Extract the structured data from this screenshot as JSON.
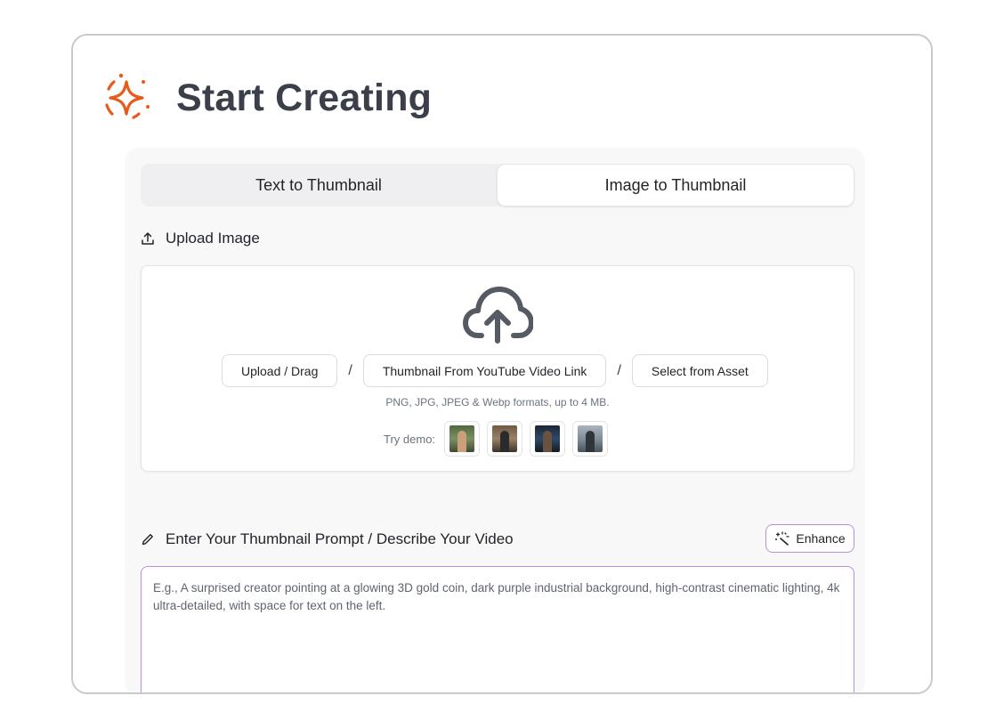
{
  "header": {
    "title": "Start Creating",
    "icon": "sparkle-icon",
    "accent_color": "#e8591a"
  },
  "tabs": [
    {
      "label": "Text to Thumbnail",
      "active": false
    },
    {
      "label": "Image to Thumbnail",
      "active": true
    }
  ],
  "upload": {
    "section_label": "Upload Image",
    "section_icon": "upload-icon",
    "cloud_icon": "cloud-upload-icon",
    "buttons": {
      "upload_drag": "Upload / Drag",
      "youtube_link": "Thumbnail From YouTube Video Link",
      "select_asset": "Select from Asset"
    },
    "separator": "/",
    "formats_hint": "PNG, JPG, JPEG & Webp formats, up to 4 MB.",
    "demo_label": "Try demo:",
    "demo_count": 4
  },
  "prompt": {
    "section_label": "Enter Your Thumbnail Prompt / Describe Your Video",
    "section_icon": "pencil-icon",
    "enhance_label": "Enhance",
    "enhance_icon": "magic-wand-icon",
    "enhance_border_color": "#b58ee0",
    "placeholder": "E.g., A surprised creator pointing at a glowing 3D gold coin, dark purple industrial background, high-contrast cinematic lighting, 4k ultra-detailed, with space for text on the left.",
    "value": ""
  }
}
